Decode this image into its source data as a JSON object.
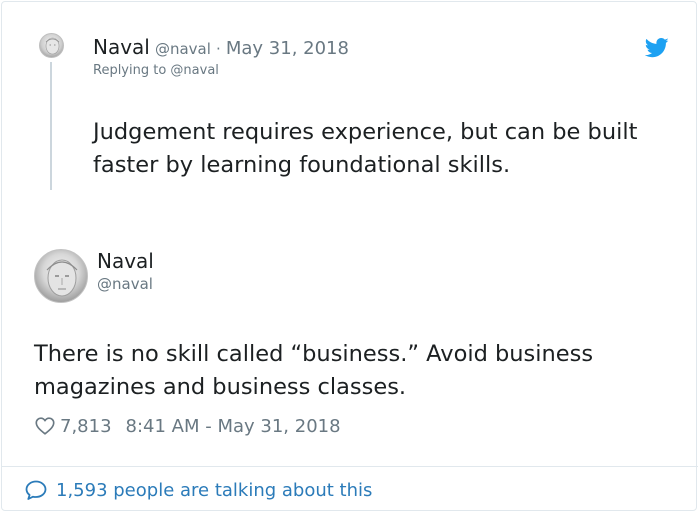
{
  "parent_tweet": {
    "name": "Naval",
    "handle": "@naval",
    "separator": "·",
    "date": "May 31, 2018",
    "replying_to": "Replying to @naval",
    "text": "Judgement requires experience, but can be built faster by learning foundational skills."
  },
  "main_tweet": {
    "name": "Naval",
    "handle": "@naval",
    "text": "There is no skill called “business.” Avoid business magazines and business classes.",
    "likes": "7,813",
    "timestamp": "8:41 AM - May 31, 2018"
  },
  "footer": {
    "text": "1,593 people are talking about this"
  },
  "icons": {
    "logo": "twitter-bird-icon",
    "like": "heart-outline-icon",
    "talking": "speech-bubble-icon"
  },
  "colors": {
    "twitter_blue": "#1da1f2",
    "link_blue": "#2b7bb9",
    "secondary_text": "#697882",
    "primary_text": "#1c2022",
    "border": "#e1e8ed"
  }
}
